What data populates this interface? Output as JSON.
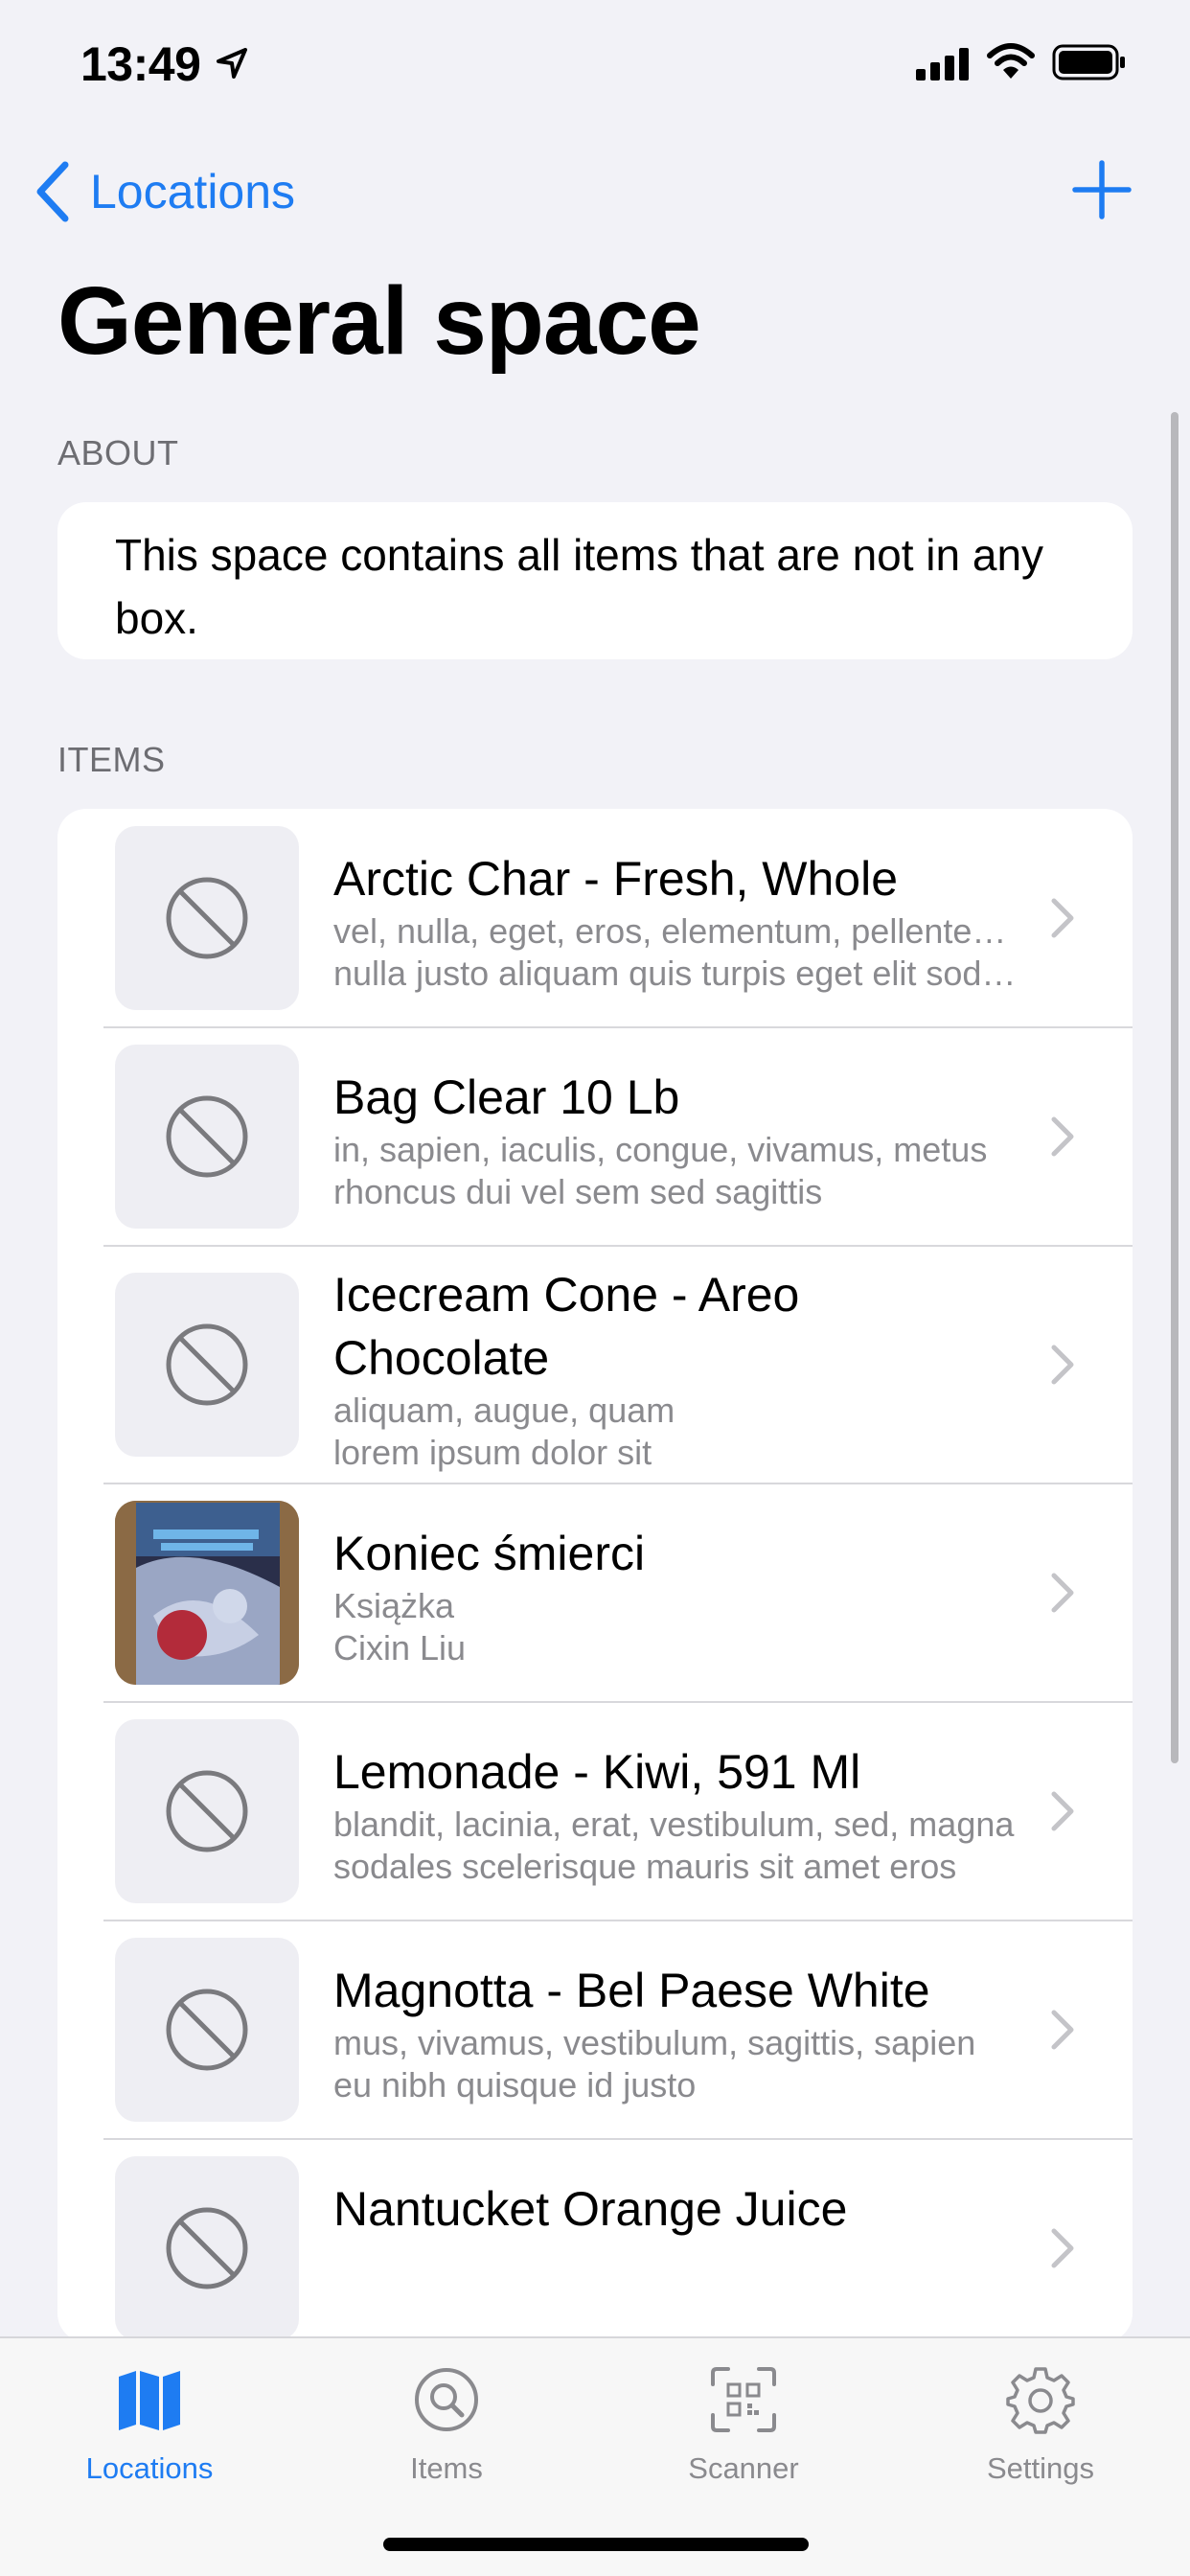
{
  "status_bar": {
    "time": "13:49"
  },
  "nav": {
    "back_label": "Locations",
    "title": "General space"
  },
  "about": {
    "header": "ABOUT",
    "text": "This space contains all items that are not in any box."
  },
  "items": {
    "header": "ITEMS",
    "rows": [
      {
        "title": "Arctic Char - Fresh, Whole",
        "line1": "vel, nulla, eget, eros, elementum, pellentesque",
        "line2": "nulla justo aliquam quis turpis eget elit sodales",
        "thumb": "no-image"
      },
      {
        "title": "Bag Clear 10 Lb",
        "line1": "in, sapien, iaculis, congue, vivamus, metus",
        "line2": "rhoncus dui vel sem sed sagittis",
        "thumb": "no-image"
      },
      {
        "title": "Icecream Cone - Areo Chocolate",
        "line1": "aliquam, augue, quam",
        "line2": "lorem ipsum dolor sit",
        "thumb": "no-image"
      },
      {
        "title": "Koniec śmierci",
        "line1": "Książka",
        "line2": "Cixin Liu",
        "thumb": "book-cover"
      },
      {
        "title": "Lemonade - Kiwi, 591 Ml",
        "line1": "blandit, lacinia, erat, vestibulum, sed, magna",
        "line2": "sodales scelerisque mauris sit amet eros",
        "thumb": "no-image"
      },
      {
        "title": "Magnotta - Bel Paese White",
        "line1": "mus, vivamus, vestibulum, sagittis, sapien",
        "line2": "eu nibh quisque id justo",
        "thumb": "no-image"
      },
      {
        "title": "Nantucket Orange Juice",
        "line1": "",
        "line2": "",
        "thumb": "no-image"
      }
    ]
  },
  "tab_bar": {
    "tabs": [
      {
        "label": "Locations",
        "icon": "map-icon",
        "active": true
      },
      {
        "label": "Items",
        "icon": "search-icon",
        "active": false
      },
      {
        "label": "Scanner",
        "icon": "qr-scanner-icon",
        "active": false
      },
      {
        "label": "Settings",
        "icon": "gear-icon",
        "active": false
      }
    ]
  },
  "colors": {
    "accent": "#1e7cf2",
    "background": "#f2f2f7",
    "secondary_text": "#8a8a8e"
  }
}
